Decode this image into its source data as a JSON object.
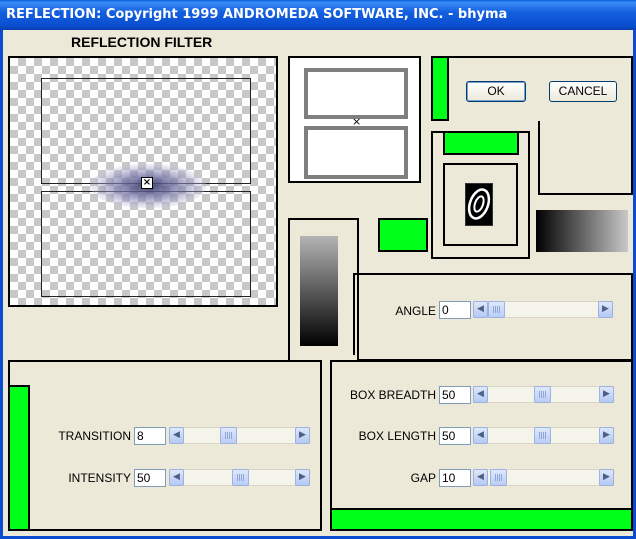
{
  "window": {
    "title": "REFLECTION: Copyright 1999 ANDROMEDA SOFTWARE, INC. - bhyma"
  },
  "header": {
    "filter_title": "REFLECTION FILTER"
  },
  "buttons": {
    "ok": "OK",
    "cancel": "CANCEL"
  },
  "controls": {
    "angle": {
      "label": "ANGLE",
      "value": "0",
      "slider_fraction": 0.05
    },
    "transition": {
      "label": "TRANSITION",
      "value": "8",
      "slider_fraction": 0.5
    },
    "intensity": {
      "label": "INTENSITY",
      "value": "50",
      "slider_fraction": 0.55
    },
    "box_breadth": {
      "label": "BOX BREADTH",
      "value": "50",
      "slider_fraction": 0.5
    },
    "box_length": {
      "label": "BOX LENGTH",
      "value": "50",
      "slider_fraction": 0.5
    },
    "gap": {
      "label": "GAP",
      "value": "10",
      "slider_fraction": 0.05
    }
  },
  "colors": {
    "accent_green": "#00ff19",
    "titlebar_blue": "#0a4fd0",
    "panel_bg": "#ece9d8"
  },
  "icons": {
    "scroll_left": "◀",
    "scroll_right": "▶"
  }
}
